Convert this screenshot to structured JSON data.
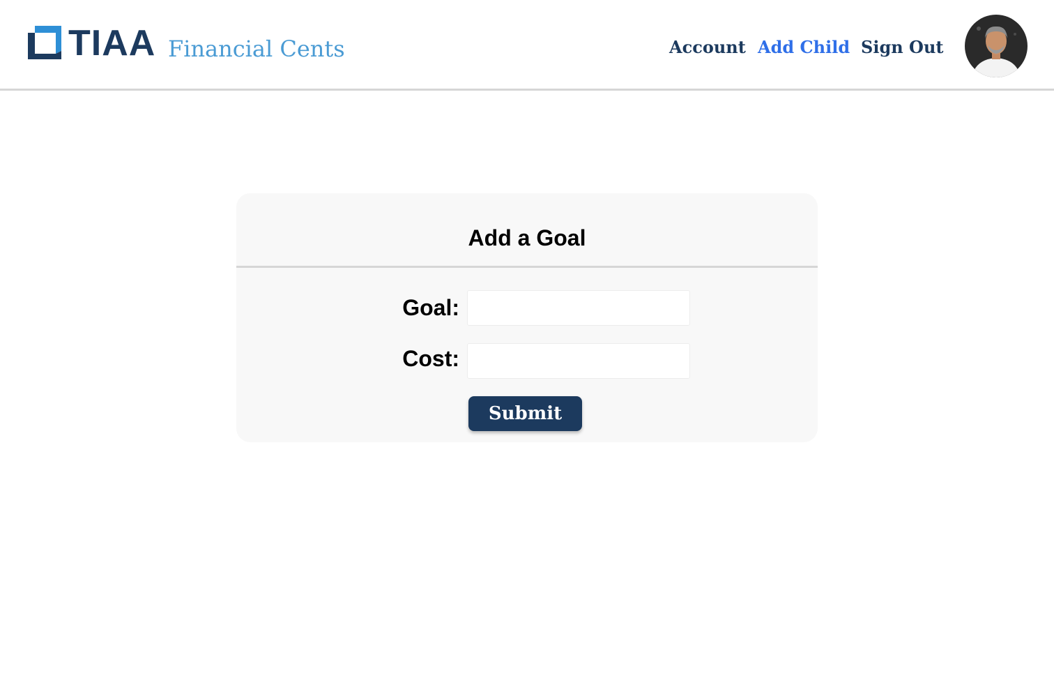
{
  "header": {
    "logo_text": "TIAA",
    "logo_icon": "tiaa-logo-icon",
    "brand_name": "Financial Cents",
    "nav": {
      "account": "Account",
      "add_child": "Add Child",
      "sign_out": "Sign Out"
    },
    "avatar_icon": "user-avatar"
  },
  "form": {
    "title": "Add a Goal",
    "fields": [
      {
        "label": "Goal:",
        "value": "",
        "placeholder": ""
      },
      {
        "label": "Cost:",
        "value": "",
        "placeholder": ""
      }
    ],
    "submit_label": "Submit"
  },
  "colors": {
    "navy": "#1c3a5e",
    "brand_light_blue": "#4a9bd4",
    "logo_light_blue": "#2e8fd6",
    "active_link": "#2f6fe8",
    "card_background": "#f8f8f8",
    "divider": "#d6d6d6"
  }
}
